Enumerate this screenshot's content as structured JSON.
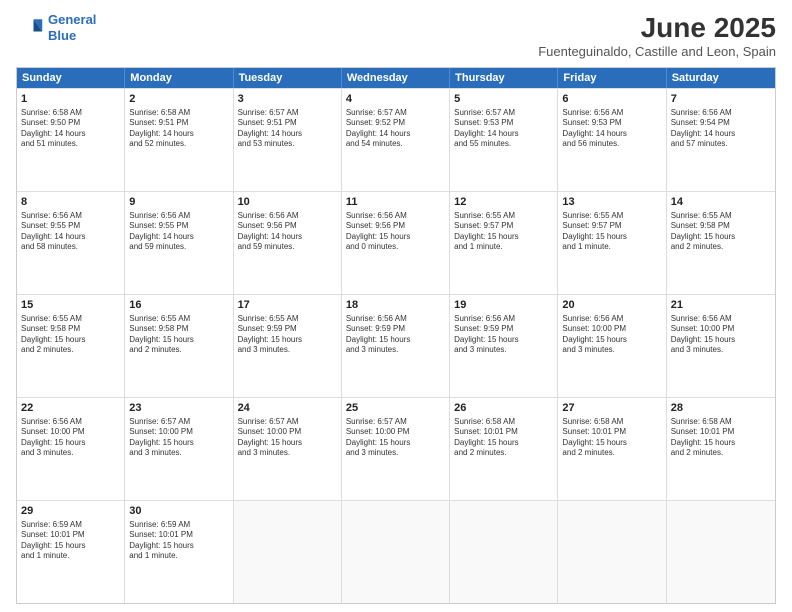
{
  "header": {
    "logo_line1": "General",
    "logo_line2": "Blue",
    "month_title": "June 2025",
    "subtitle": "Fuenteguinaldo, Castille and Leon, Spain"
  },
  "weekdays": [
    "Sunday",
    "Monday",
    "Tuesday",
    "Wednesday",
    "Thursday",
    "Friday",
    "Saturday"
  ],
  "rows": [
    [
      {
        "day": "1",
        "lines": [
          "Sunrise: 6:58 AM",
          "Sunset: 9:50 PM",
          "Daylight: 14 hours",
          "and 51 minutes."
        ]
      },
      {
        "day": "2",
        "lines": [
          "Sunrise: 6:58 AM",
          "Sunset: 9:51 PM",
          "Daylight: 14 hours",
          "and 52 minutes."
        ]
      },
      {
        "day": "3",
        "lines": [
          "Sunrise: 6:57 AM",
          "Sunset: 9:51 PM",
          "Daylight: 14 hours",
          "and 53 minutes."
        ]
      },
      {
        "day": "4",
        "lines": [
          "Sunrise: 6:57 AM",
          "Sunset: 9:52 PM",
          "Daylight: 14 hours",
          "and 54 minutes."
        ]
      },
      {
        "day": "5",
        "lines": [
          "Sunrise: 6:57 AM",
          "Sunset: 9:53 PM",
          "Daylight: 14 hours",
          "and 55 minutes."
        ]
      },
      {
        "day": "6",
        "lines": [
          "Sunrise: 6:56 AM",
          "Sunset: 9:53 PM",
          "Daylight: 14 hours",
          "and 56 minutes."
        ]
      },
      {
        "day": "7",
        "lines": [
          "Sunrise: 6:56 AM",
          "Sunset: 9:54 PM",
          "Daylight: 14 hours",
          "and 57 minutes."
        ]
      }
    ],
    [
      {
        "day": "8",
        "lines": [
          "Sunrise: 6:56 AM",
          "Sunset: 9:55 PM",
          "Daylight: 14 hours",
          "and 58 minutes."
        ]
      },
      {
        "day": "9",
        "lines": [
          "Sunrise: 6:56 AM",
          "Sunset: 9:55 PM",
          "Daylight: 14 hours",
          "and 59 minutes."
        ]
      },
      {
        "day": "10",
        "lines": [
          "Sunrise: 6:56 AM",
          "Sunset: 9:56 PM",
          "Daylight: 14 hours",
          "and 59 minutes."
        ]
      },
      {
        "day": "11",
        "lines": [
          "Sunrise: 6:56 AM",
          "Sunset: 9:56 PM",
          "Daylight: 15 hours",
          "and 0 minutes."
        ]
      },
      {
        "day": "12",
        "lines": [
          "Sunrise: 6:55 AM",
          "Sunset: 9:57 PM",
          "Daylight: 15 hours",
          "and 1 minute."
        ]
      },
      {
        "day": "13",
        "lines": [
          "Sunrise: 6:55 AM",
          "Sunset: 9:57 PM",
          "Daylight: 15 hours",
          "and 1 minute."
        ]
      },
      {
        "day": "14",
        "lines": [
          "Sunrise: 6:55 AM",
          "Sunset: 9:58 PM",
          "Daylight: 15 hours",
          "and 2 minutes."
        ]
      }
    ],
    [
      {
        "day": "15",
        "lines": [
          "Sunrise: 6:55 AM",
          "Sunset: 9:58 PM",
          "Daylight: 15 hours",
          "and 2 minutes."
        ]
      },
      {
        "day": "16",
        "lines": [
          "Sunrise: 6:55 AM",
          "Sunset: 9:58 PM",
          "Daylight: 15 hours",
          "and 2 minutes."
        ]
      },
      {
        "day": "17",
        "lines": [
          "Sunrise: 6:55 AM",
          "Sunset: 9:59 PM",
          "Daylight: 15 hours",
          "and 3 minutes."
        ]
      },
      {
        "day": "18",
        "lines": [
          "Sunrise: 6:56 AM",
          "Sunset: 9:59 PM",
          "Daylight: 15 hours",
          "and 3 minutes."
        ]
      },
      {
        "day": "19",
        "lines": [
          "Sunrise: 6:56 AM",
          "Sunset: 9:59 PM",
          "Daylight: 15 hours",
          "and 3 minutes."
        ]
      },
      {
        "day": "20",
        "lines": [
          "Sunrise: 6:56 AM",
          "Sunset: 10:00 PM",
          "Daylight: 15 hours",
          "and 3 minutes."
        ]
      },
      {
        "day": "21",
        "lines": [
          "Sunrise: 6:56 AM",
          "Sunset: 10:00 PM",
          "Daylight: 15 hours",
          "and 3 minutes."
        ]
      }
    ],
    [
      {
        "day": "22",
        "lines": [
          "Sunrise: 6:56 AM",
          "Sunset: 10:00 PM",
          "Daylight: 15 hours",
          "and 3 minutes."
        ]
      },
      {
        "day": "23",
        "lines": [
          "Sunrise: 6:57 AM",
          "Sunset: 10:00 PM",
          "Daylight: 15 hours",
          "and 3 minutes."
        ]
      },
      {
        "day": "24",
        "lines": [
          "Sunrise: 6:57 AM",
          "Sunset: 10:00 PM",
          "Daylight: 15 hours",
          "and 3 minutes."
        ]
      },
      {
        "day": "25",
        "lines": [
          "Sunrise: 6:57 AM",
          "Sunset: 10:00 PM",
          "Daylight: 15 hours",
          "and 3 minutes."
        ]
      },
      {
        "day": "26",
        "lines": [
          "Sunrise: 6:58 AM",
          "Sunset: 10:01 PM",
          "Daylight: 15 hours",
          "and 2 minutes."
        ]
      },
      {
        "day": "27",
        "lines": [
          "Sunrise: 6:58 AM",
          "Sunset: 10:01 PM",
          "Daylight: 15 hours",
          "and 2 minutes."
        ]
      },
      {
        "day": "28",
        "lines": [
          "Sunrise: 6:58 AM",
          "Sunset: 10:01 PM",
          "Daylight: 15 hours",
          "and 2 minutes."
        ]
      }
    ],
    [
      {
        "day": "29",
        "lines": [
          "Sunrise: 6:59 AM",
          "Sunset: 10:01 PM",
          "Daylight: 15 hours",
          "and 1 minute."
        ]
      },
      {
        "day": "30",
        "lines": [
          "Sunrise: 6:59 AM",
          "Sunset: 10:01 PM",
          "Daylight: 15 hours",
          "and 1 minute."
        ]
      },
      {
        "day": "",
        "lines": []
      },
      {
        "day": "",
        "lines": []
      },
      {
        "day": "",
        "lines": []
      },
      {
        "day": "",
        "lines": []
      },
      {
        "day": "",
        "lines": []
      }
    ]
  ]
}
